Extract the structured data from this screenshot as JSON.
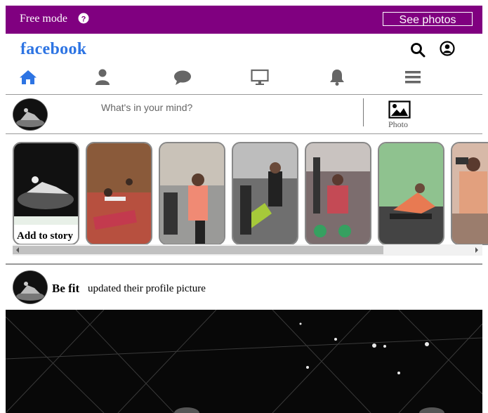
{
  "topbar": {
    "free_mode": "Free mode",
    "see_photos": "See photos",
    "color": "#800080"
  },
  "header": {
    "brand": "facebook",
    "brand_color": "#2d74e3"
  },
  "nav": {
    "items": [
      {
        "name": "home",
        "icon": "home-icon",
        "active": true
      },
      {
        "name": "profile",
        "icon": "user-icon"
      },
      {
        "name": "messages",
        "icon": "chat-bubble-icon"
      },
      {
        "name": "watch",
        "icon": "desktop-icon"
      },
      {
        "name": "notifications",
        "icon": "bell-icon"
      },
      {
        "name": "menu",
        "icon": "hamburger-icon"
      }
    ]
  },
  "composer": {
    "placeholder": "What's in your mind?",
    "photo_label": "Photo"
  },
  "stories": {
    "add_label": "Add to story",
    "count": 7
  },
  "post": {
    "author": "Be fit",
    "action": "updated their profile picture"
  }
}
